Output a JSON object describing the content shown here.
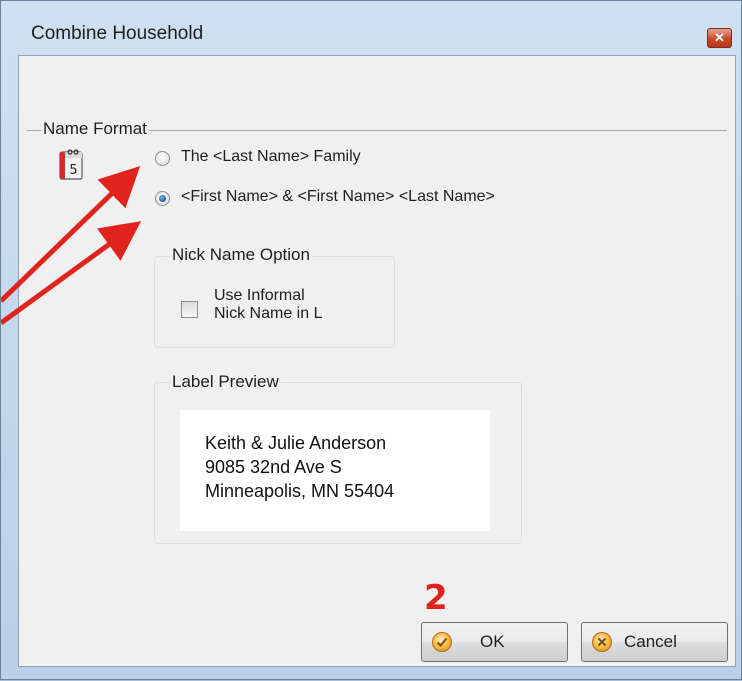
{
  "window": {
    "title": "Combine Household",
    "close_icon": "close-icon"
  },
  "name_format": {
    "legend": "Name Format",
    "options": [
      {
        "label": "The <Last Name> Family",
        "checked": false
      },
      {
        "label": "<First Name> & <First Name> <Last Name>",
        "checked": true
      }
    ],
    "calendar_icon_text": "5"
  },
  "nick_name": {
    "legend": "Nick Name Option",
    "checkbox_line1": "Use Informal",
    "checkbox_line2": "Nick Name in L",
    "checked": false
  },
  "label_preview": {
    "legend": "Label Preview",
    "lines": [
      "Keith & Julie Anderson",
      "9085 32nd Ave S",
      "Minneapolis, MN 55404"
    ]
  },
  "buttons": {
    "ok": "OK",
    "cancel": "Cancel"
  },
  "annotations": {
    "step_number": "2"
  },
  "colors": {
    "annotation": "#e0231c",
    "title_bar": "#cfe0f1",
    "client_bg": "#f0f0f0"
  }
}
